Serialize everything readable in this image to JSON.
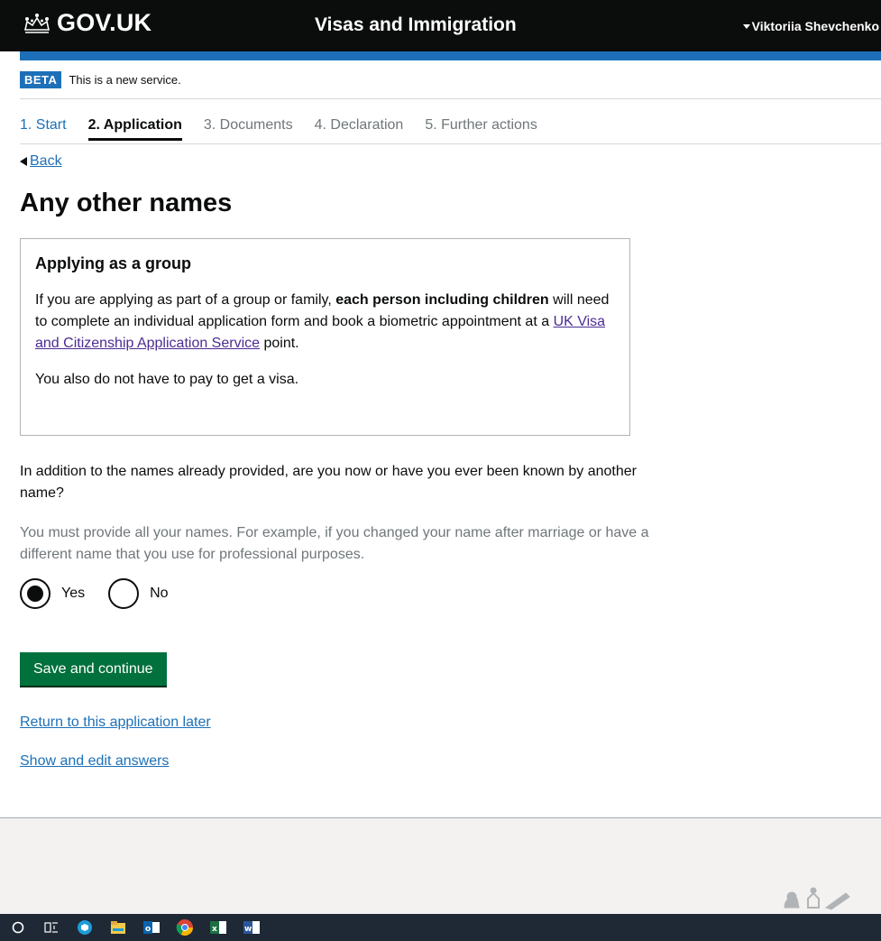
{
  "header": {
    "logo_text": "GOV.UK",
    "service_name": "Visas and Immigration",
    "user_name": "Viktoriia Shevchenko"
  },
  "phase_banner": {
    "tag": "BETA",
    "text": "This is a new service."
  },
  "steps": [
    {
      "label": "1. Start",
      "state": "done"
    },
    {
      "label": "2. Application",
      "state": "current"
    },
    {
      "label": "3. Documents",
      "state": "todo"
    },
    {
      "label": "4. Declaration",
      "state": "todo"
    },
    {
      "label": "5. Further actions",
      "state": "todo"
    }
  ],
  "back_link": "Back",
  "page_title": "Any other names",
  "inset": {
    "heading": "Applying as a group",
    "p1_start": "If you are applying as part of a group or family, ",
    "p1_bold": "each person including children",
    "p1_mid": " will need to complete an individual application form and book a biometric appointment at a ",
    "p1_link": "UK Visa and Citizenship Application Service",
    "p1_end": " point.",
    "p2": "You also do not have to pay to get a visa."
  },
  "question": "In addition to the names already provided, are you now or have you ever been known by another name?",
  "hint": "You must provide all your names. For example, if you changed your name after marriage or have a different name that you use for professional purposes.",
  "radios": {
    "yes_label": "Yes",
    "no_label": "No",
    "selected": "yes"
  },
  "primary_button": "Save and continue",
  "links": {
    "return_later": "Return to this application later",
    "show_edit": "Show and edit answers"
  },
  "colors": {
    "header_bg": "#0b0c0c",
    "brand_blue": "#1d70b8",
    "button_green": "#00703c",
    "taskbar_bg": "#1f2936"
  },
  "taskbar_icons": [
    "cortana-search-icon",
    "task-view-icon",
    "app-3d-icon",
    "file-explorer-icon",
    "outlook-icon",
    "chrome-icon",
    "excel-icon",
    "word-icon"
  ]
}
